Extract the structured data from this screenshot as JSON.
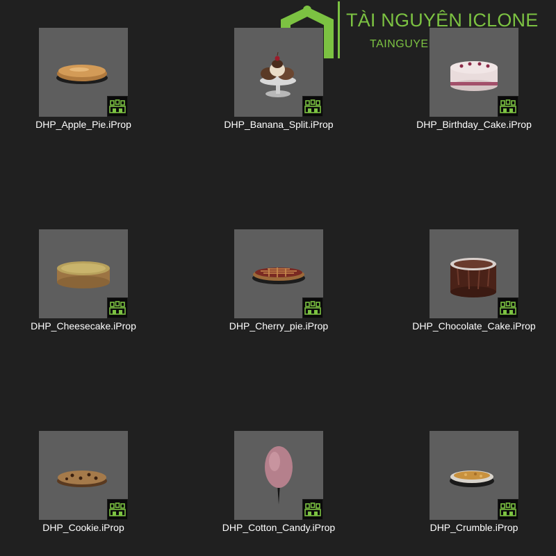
{
  "watermark": {
    "title": "TÀI NGUYÊN ICLONE",
    "subtitle": "TAINGUYENICLONE.COM",
    "brand_color": "#7cc242"
  },
  "files": [
    {
      "name": "DHP_Apple_Pie.iProp",
      "icon": "apple-pie-thumbnail",
      "badge_icon": "iclone-prop-icon"
    },
    {
      "name": "DHP_Banana_Split.iProp",
      "icon": "banana-split-thumbnail",
      "badge_icon": "iclone-prop-icon"
    },
    {
      "name": "DHP_Birthday_Cake.iProp",
      "icon": "birthday-cake-thumbnail",
      "badge_icon": "iclone-prop-icon"
    },
    {
      "name": "DHP_Cheesecake.iProp",
      "icon": "cheesecake-thumbnail",
      "badge_icon": "iclone-prop-icon"
    },
    {
      "name": "DHP_Cherry_pie.iProp",
      "icon": "cherry-pie-thumbnail",
      "badge_icon": "iclone-prop-icon"
    },
    {
      "name": "DHP_Chocolate_Cake.iProp",
      "icon": "chocolate-cake-thumbnail",
      "badge_icon": "iclone-prop-icon"
    },
    {
      "name": "DHP_Cookie.iProp",
      "icon": "cookie-thumbnail",
      "badge_icon": "iclone-prop-icon"
    },
    {
      "name": "DHP_Cotton_Candy.iProp",
      "icon": "cotton-candy-thumbnail",
      "badge_icon": "iclone-prop-icon"
    },
    {
      "name": "DHP_Crumble.iProp",
      "icon": "crumble-thumbnail",
      "badge_icon": "iclone-prop-icon"
    }
  ]
}
